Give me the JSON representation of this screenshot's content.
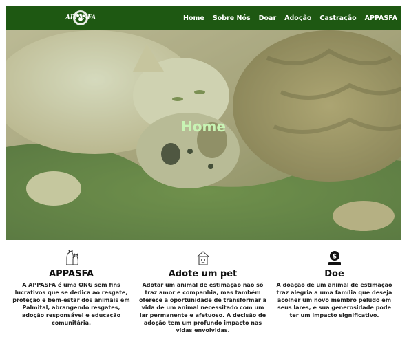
{
  "brand": {
    "logo_text": "APPASFA"
  },
  "nav": {
    "items": [
      "Home",
      "Sobre Nós",
      "Doar",
      "Adoção",
      "Castração",
      "APPASFA"
    ]
  },
  "hero": {
    "title": "Home"
  },
  "features": [
    {
      "icon": "dog-cat-icon",
      "title": "APPASFA",
      "text": "A APPASFA é uma ONG sem fins lucrativos que se dedica ao resgate, proteção e bem-estar dos animais em Palmital, abrangendo resgates, adoção responsável e educação comunitária."
    },
    {
      "icon": "pet-house-icon",
      "title": "Adote um pet",
      "text": "Adotar um animal de estimação não só traz amor e companhia, mas também oferece a oportunidade de transformar a vida de um animal necessitado com um lar permanente e afetuoso. A decisão de adoção tem um profundo impacto nas vidas envolvidas."
    },
    {
      "icon": "donation-icon",
      "title": "Doe",
      "text": "A doação de um animal de estimação traz alegria a uma família que deseja acolher um novo membro peludo em seus lares, e sua generosidade pode ter um impacto significativo."
    }
  ],
  "colors": {
    "nav_bg": "#1e5812",
    "hero_title": "#c8f4b4",
    "accent_green": "#2e7d1a"
  }
}
